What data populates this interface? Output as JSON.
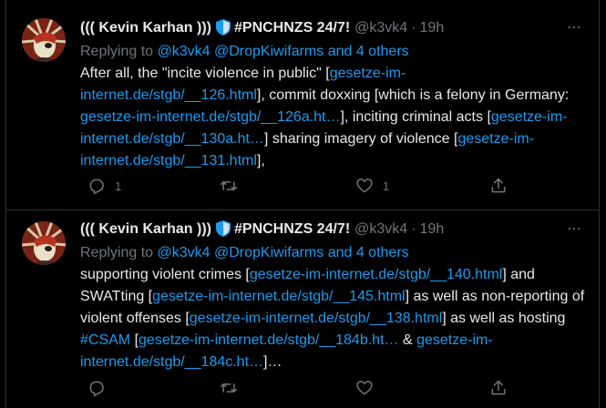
{
  "tweets": [
    {
      "author_name": "((( Kevin Karhan )))",
      "author_suffix": "#PNCHNZS 24/7!",
      "handle": "@k3vk4",
      "dot": "·",
      "time": "19h",
      "more_icon": "⋯",
      "replying_prefix": "Replying to",
      "replying_to": "@k3vk4 @DropKiwifarms and 4 others",
      "body_parts": [
        {
          "t": "After all, the \"incite violence in public\" [",
          "link": false
        },
        {
          "t": "gesetze-im-internet.de/stgb/__126.html",
          "link": true
        },
        {
          "t": "], commit doxxing [which is a felony in Germany: ",
          "link": false
        },
        {
          "t": "gesetze-im-internet.de/stgb/__126a.ht…",
          "link": true
        },
        {
          "t": "], inciting criminal acts [",
          "link": false
        },
        {
          "t": "gesetze-im-internet.de/stgb/__130a.ht…",
          "link": true
        },
        {
          "t": "] sharing imagery of violence [",
          "link": false
        },
        {
          "t": "gesetze-im-internet.de/stgb/__131.html",
          "link": true
        },
        {
          "t": "],",
          "link": false
        }
      ],
      "reply_count": "1",
      "retweet_count": "",
      "like_count": "1"
    },
    {
      "author_name": "((( Kevin Karhan )))",
      "author_suffix": "#PNCHNZS 24/7!",
      "handle": "@k3vk4",
      "dot": "·",
      "time": "19h",
      "more_icon": "⋯",
      "replying_prefix": "Replying to",
      "replying_to": "@k3vk4 @DropKiwifarms and 4 others",
      "body_parts": [
        {
          "t": "supporting violent crimes [",
          "link": false
        },
        {
          "t": "gesetze-im-internet.de/stgb/__140.html",
          "link": true
        },
        {
          "t": "] and SWATting [",
          "link": false
        },
        {
          "t": "gesetze-im-internet.de/stgb/__145.html",
          "link": true
        },
        {
          "t": "] as well as non-reporting of violent offenses [",
          "link": false
        },
        {
          "t": "gesetze-im-internet.de/stgb/__138.html",
          "link": true
        },
        {
          "t": "] as well as hosting ",
          "link": false
        },
        {
          "t": "#CSAM",
          "link": true
        },
        {
          "t": " [",
          "link": false
        },
        {
          "t": "gesetze-im-internet.de/stgb/__184b.ht…",
          "link": true
        },
        {
          "t": " & ",
          "link": false
        },
        {
          "t": "gesetze-im-internet.de/stgb/__184c.ht…",
          "link": true
        },
        {
          "t": "]…",
          "link": false
        }
      ],
      "reply_count": "",
      "retweet_count": "",
      "like_count": ""
    }
  ],
  "icons": {
    "reply": "reply-icon",
    "retweet": "retweet-icon",
    "like": "heart-icon",
    "share": "share-icon",
    "verified": "shield-icon"
  },
  "colors": {
    "background": "#000000",
    "text": "#e7e9ea",
    "secondary": "#71767b",
    "link": "#1d9bf0",
    "border": "#2f3336",
    "shield": "#1d9bf0"
  }
}
